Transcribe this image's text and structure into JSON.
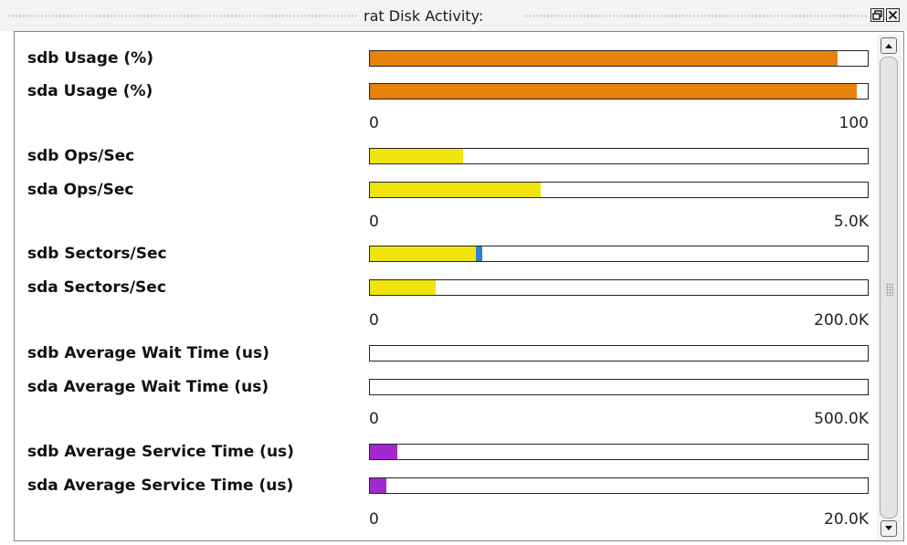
{
  "window": {
    "title": "rat Disk Activity:",
    "restore_icon": "restore-icon",
    "close_icon": "close-icon"
  },
  "groups": [
    {
      "scale_min": "0",
      "scale_max": "100",
      "rows": [
        {
          "label": "sdb Usage (%)",
          "fill_fraction": 0.94,
          "color": "#e8820c"
        },
        {
          "label": "sda Usage (%)",
          "fill_fraction": 0.978,
          "color": "#e8820c"
        }
      ]
    },
    {
      "scale_min": "0",
      "scale_max": "5.0K",
      "rows": [
        {
          "label": "sdb Ops/Sec",
          "fill_fraction": 0.187,
          "color": "#f0e50a"
        },
        {
          "label": "sda Ops/Sec",
          "fill_fraction": 0.343,
          "color": "#f0e50a"
        }
      ]
    },
    {
      "scale_min": "0",
      "scale_max": "200.0K",
      "rows": [
        {
          "label": "sdb Sectors/Sec",
          "fill_fraction": 0.212,
          "color": "#f0e50a",
          "extra_fill_fraction": 0.013,
          "extra_color": "#2a7fd6"
        },
        {
          "label": "sda Sectors/Sec",
          "fill_fraction": 0.132,
          "color": "#f0e50a"
        }
      ]
    },
    {
      "scale_min": "0",
      "scale_max": "500.0K",
      "rows": [
        {
          "label": "sdb Average Wait Time (us)",
          "fill_fraction": 0.0,
          "color": "#a02ad0"
        },
        {
          "label": "sda Average Wait Time (us)",
          "fill_fraction": 0.0,
          "color": "#a02ad0"
        }
      ]
    },
    {
      "scale_min": "0",
      "scale_max": "20.0K",
      "rows": [
        {
          "label": "sdb Average Service Time (us)",
          "fill_fraction": 0.055,
          "color": "#a02ad0"
        },
        {
          "label": "sda Average Service Time (us)",
          "fill_fraction": 0.033,
          "color": "#a02ad0"
        }
      ]
    }
  ],
  "scrollbar": {
    "up_icon": "scroll-up-arrow-icon",
    "down_icon": "scroll-down-arrow-icon"
  }
}
